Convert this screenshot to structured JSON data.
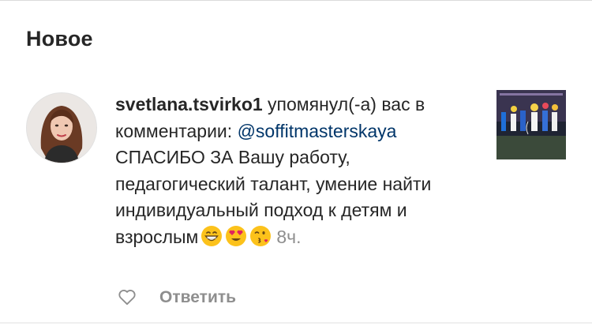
{
  "section": {
    "title": "Новое"
  },
  "notification": {
    "username": "svetlana.tsvirko1",
    "action_text": " упомянул(-а) вас в комментарии: ",
    "mention": "@soffitmasterskaya",
    "comment_text": " СПАСИБО ЗА Вашу работу, педагогический талант, умение найти индивидуальный подход к детям и взрослым",
    "emojis": [
      "grinning-face-emoji",
      "heart-eyes-emoji",
      "face-blowing-kiss-emoji"
    ],
    "timestamp": "8ч.",
    "like_icon": "heart-outline-icon",
    "reply_label": "Ответить"
  },
  "colors": {
    "text": "#262626",
    "mention": "#003569",
    "secondary": "#8e8e8e",
    "divider": "#dbdbdb"
  }
}
